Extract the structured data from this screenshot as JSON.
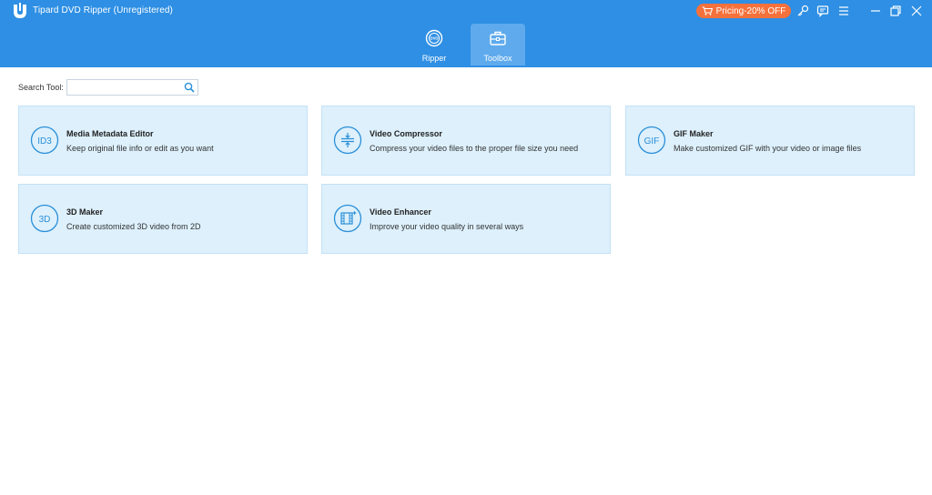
{
  "window": {
    "title": "Tipard DVD Ripper (Unregistered)"
  },
  "header": {
    "pricing_label": "Pricing-20% OFF",
    "icons": [
      "key-icon",
      "feedback-icon",
      "menu-icon",
      "minimize-icon",
      "restore-icon",
      "close-icon"
    ]
  },
  "nav": {
    "tabs": [
      {
        "label": "Ripper",
        "icon": "dvd-icon",
        "active": false
      },
      {
        "label": "Toolbox",
        "icon": "toolbox-icon",
        "active": true
      }
    ]
  },
  "search": {
    "label": "Search Tool:",
    "value": "",
    "placeholder": ""
  },
  "tools": [
    {
      "title": "Media Metadata Editor",
      "description": "Keep original file info or edit as you want",
      "icon": "id3-icon"
    },
    {
      "title": "Video Compressor",
      "description": "Compress your video files to the proper file size you need",
      "icon": "compress-icon"
    },
    {
      "title": "GIF Maker",
      "description": "Make customized GIF with your video or image files",
      "icon": "gif-icon"
    },
    {
      "title": "3D Maker",
      "description": "Create customized 3D video from 2D",
      "icon": "3d-icon"
    },
    {
      "title": "Video Enhancer",
      "description": "Improve your video quality in several ways",
      "icon": "enhance-icon"
    }
  ],
  "colors": {
    "header": "#2e8fe4",
    "active_tab": "#5eaaed",
    "pricing": "#f5713c",
    "card_bg": "#ddf0fc",
    "card_border": "#c4e2f6",
    "icon_accent": "#2a8fd8"
  }
}
